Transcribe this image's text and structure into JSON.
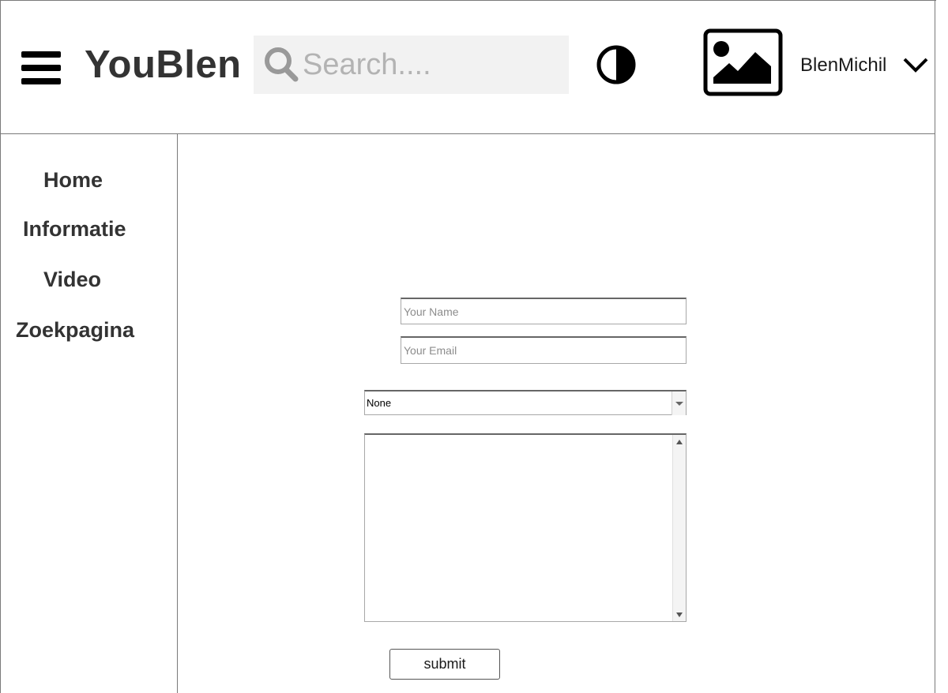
{
  "header": {
    "menu_icon": "hamburger-menu-icon",
    "logo": "YouBlen",
    "search": {
      "placeholder": "Search....",
      "value": "",
      "icon": "search-icon"
    },
    "contrast_icon": "contrast-toggle-icon",
    "avatar_icon": "image-placeholder-icon",
    "username": "BlenMichil",
    "user_menu_icon": "chevron-down-icon"
  },
  "sidebar": {
    "items": [
      {
        "label": "Home"
      },
      {
        "label": "Informatie"
      },
      {
        "label": "Video"
      },
      {
        "label": "Zoekpagina"
      }
    ]
  },
  "form": {
    "name": {
      "placeholder": "Your Name",
      "value": ""
    },
    "email": {
      "placeholder": "Your Email",
      "value": ""
    },
    "select": {
      "selected": "None"
    },
    "message": {
      "value": ""
    },
    "submit_label": "submit"
  },
  "colors": {
    "text": "#333333",
    "border": "#7a7a7a",
    "search_bg": "#f2f2f2",
    "placeholder": "#b3b3b3"
  }
}
